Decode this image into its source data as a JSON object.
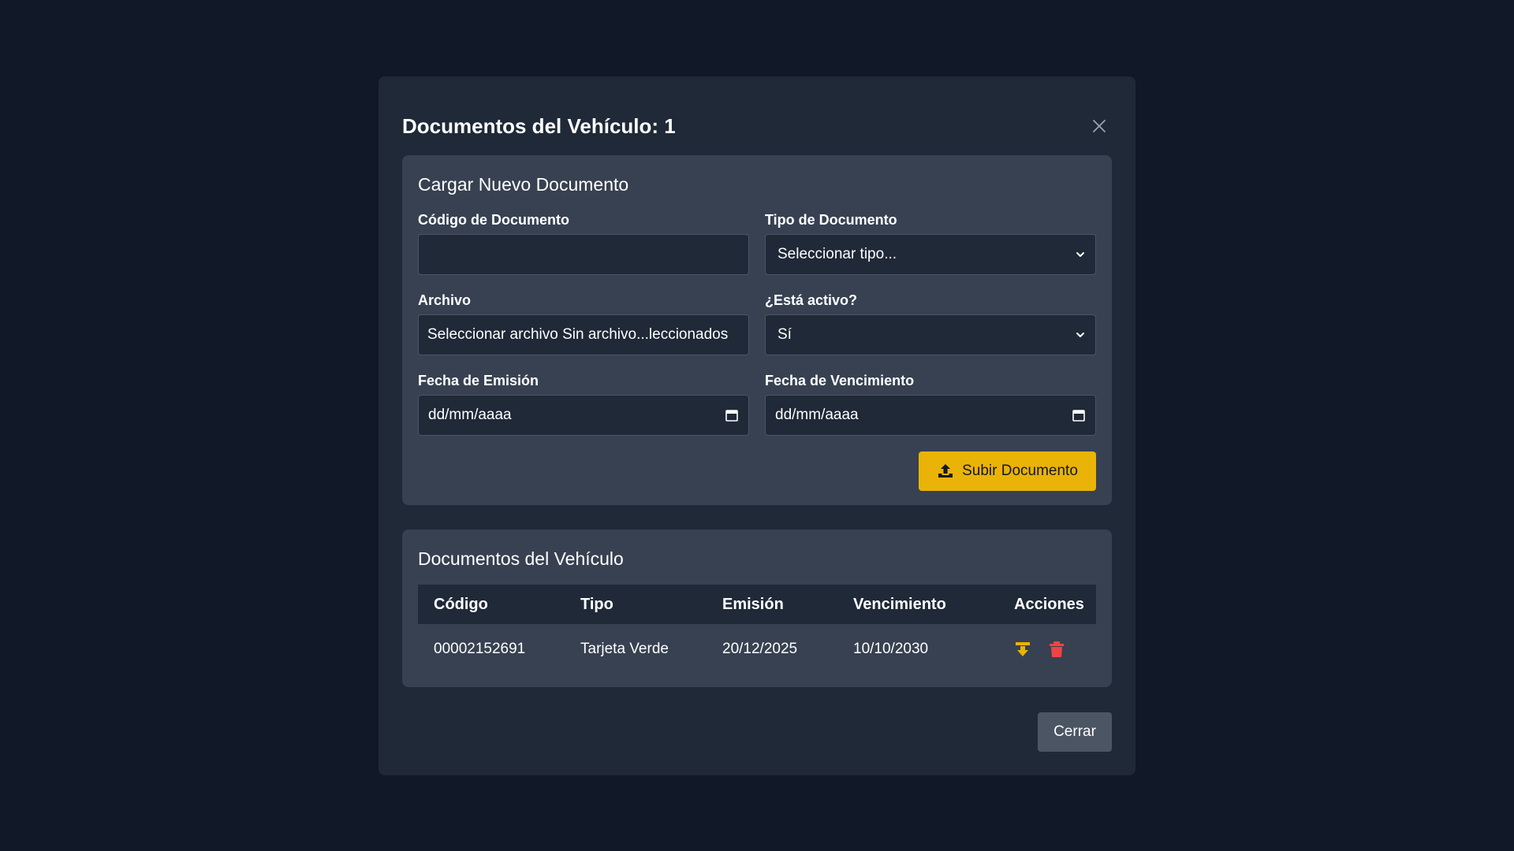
{
  "modal": {
    "title": "Documentos del Vehículo: 1",
    "close_label": "Cerrar"
  },
  "upload": {
    "title": "Cargar Nuevo Documento",
    "codigo_label": "Código de Documento",
    "codigo_value": "",
    "tipo_label": "Tipo de Documento",
    "tipo_value": "Seleccionar tipo...",
    "archivo_label": "Archivo",
    "archivo_value": "Seleccionar archivo Sin archivo...leccionados",
    "activo_label": "¿Está activo?",
    "activo_value": "Sí",
    "emision_label": "Fecha de Emisión",
    "emision_placeholder": "dd/mm/aaaa",
    "vencimiento_label": "Fecha de Vencimiento",
    "vencimiento_placeholder": "dd/mm/aaaa",
    "submit_label": "Subir Documento"
  },
  "documents": {
    "title": "Documentos del Vehículo",
    "headers": {
      "codigo": "Código",
      "tipo": "Tipo",
      "emision": "Emisión",
      "vencimiento": "Vencimiento",
      "acciones": "Acciones"
    },
    "rows": [
      {
        "codigo": "00002152691",
        "tipo": "Tarjeta Verde",
        "emision": "20/12/2025",
        "vencimiento": "10/10/2030"
      }
    ]
  },
  "icons": {
    "close": "close-icon",
    "calendar": "calendar-icon",
    "chevron": "chevron-down-icon",
    "upload": "upload-icon",
    "download": "download-icon",
    "delete": "trash-icon"
  },
  "colors": {
    "background": "#111827",
    "modal": "#1f2937",
    "card": "#374151",
    "accent": "#eab308",
    "danger": "#ef4444",
    "secondary_button": "#4b5563"
  }
}
